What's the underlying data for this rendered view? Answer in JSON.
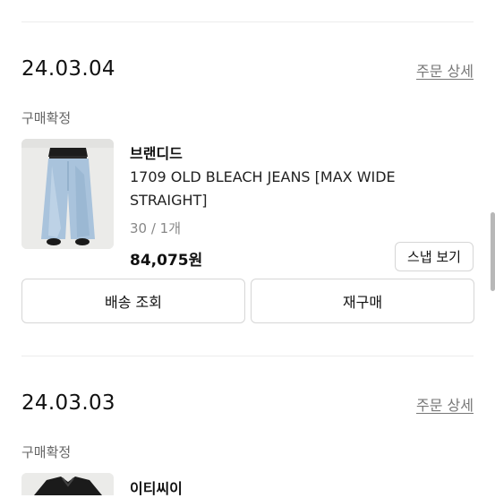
{
  "orders": [
    {
      "date": "24.03.04",
      "detail_link": "주문 상세",
      "status": "구매확정",
      "brand": "브랜디드",
      "product_name": "1709 OLD BLEACH JEANS [MAX WIDE STRAIGHT]",
      "option": "30 / 1개",
      "price": "84,075원",
      "snap_button": "스냅 보기",
      "shipping_button": "배송 조회",
      "rebuy_button": "재구매"
    },
    {
      "date": "24.03.03",
      "detail_link": "주문 상세",
      "status": "구매확정",
      "brand": "이티씨이"
    }
  ]
}
